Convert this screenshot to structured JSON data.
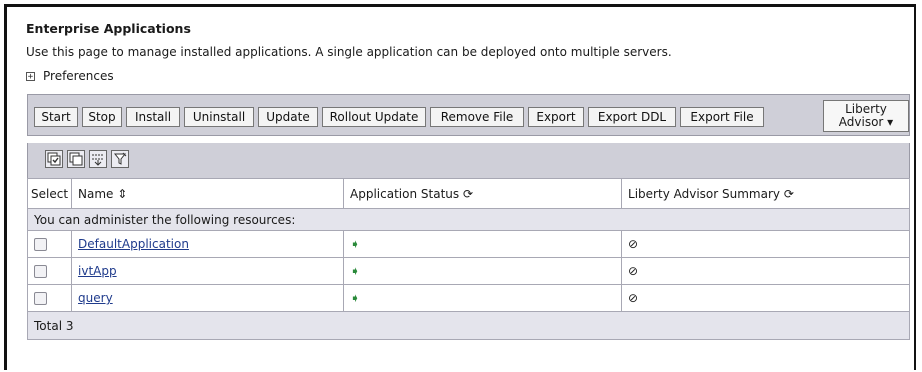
{
  "page": {
    "title": "Enterprise Applications",
    "description": "Use this page to manage installed applications. A single application can be deployed onto multiple servers.",
    "preferences_label": "Preferences"
  },
  "toolbar": {
    "buttons": [
      "Start",
      "Stop",
      "Install",
      "Uninstall",
      "Update",
      "Rollout Update",
      "Remove File",
      "Export",
      "Export DDL",
      "Export File"
    ],
    "liberty_advisor_line1": "Liberty",
    "liberty_advisor_line2": "Advisor ▾"
  },
  "table": {
    "headers": {
      "select": "Select",
      "name": "Name",
      "name_sort_icon": "⇕",
      "status": "Application Status",
      "summary": "Liberty Advisor Summary"
    },
    "notice": "You can administer the following resources:",
    "rows": [
      {
        "name": "DefaultApplication",
        "status_icon": "➧",
        "summary_icon": "⊘"
      },
      {
        "name": "ivtApp",
        "status_icon": "➧",
        "summary_icon": "⊘"
      },
      {
        "name": "query",
        "status_icon": "➧",
        "summary_icon": "⊘"
      }
    ],
    "total": "Total 3"
  },
  "colors": {
    "toolbar_bg": "#cfcfd8",
    "link": "#1f3b8c",
    "started_arrow": "#2a8a3a"
  }
}
